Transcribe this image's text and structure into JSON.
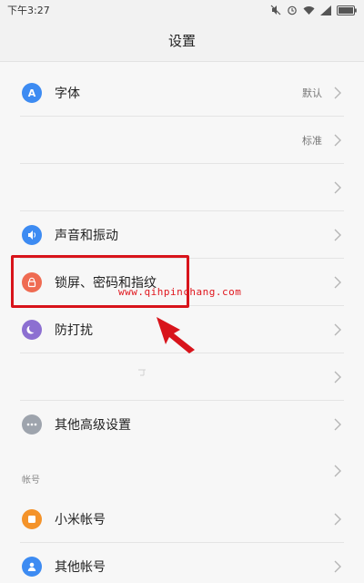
{
  "status_bar": {
    "time": "下午3:27"
  },
  "header": {
    "title": "设置"
  },
  "rows": [
    {
      "label": "字体",
      "value": "默认",
      "icon": "font-icon",
      "color": "#3d8bf2",
      "glyph": "A"
    },
    {
      "label": "",
      "value": "标准",
      "icon": "",
      "color": "",
      "glyph": ""
    },
    {
      "label": "",
      "value": "",
      "icon": "",
      "color": "",
      "glyph": ""
    },
    {
      "label": "声音和振动",
      "value": "",
      "icon": "speaker-icon",
      "color": "#3d8bf2",
      "glyph": ""
    },
    {
      "label": "锁屏、密码和指纹",
      "value": "",
      "icon": "lock-icon",
      "color": "#ef6b52",
      "glyph": ""
    },
    {
      "label": "防打扰",
      "value": "",
      "icon": "moon-icon",
      "color": "#8c6fd1",
      "glyph": ""
    },
    {
      "label": "",
      "value": "",
      "icon": "",
      "color": "",
      "glyph": ""
    },
    {
      "label": "其他高级设置",
      "value": "",
      "icon": "more-icon",
      "color": "#9ea4ad",
      "glyph": ""
    }
  ],
  "account_section": {
    "header": "帐号",
    "rows": [
      {
        "label": "小米帐号",
        "icon": "mi-account-icon",
        "color": "#f4932a"
      },
      {
        "label": "其他帐号",
        "icon": "user-icon",
        "color": "#3d8bf2"
      }
    ]
  },
  "annotation": {
    "watermark": "www.qihpinchang.com",
    "highlight_color": "#d8141b"
  }
}
